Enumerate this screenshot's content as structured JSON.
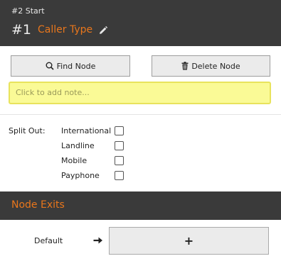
{
  "header": {
    "breadcrumb": "#2 Start",
    "node_number": "#1",
    "node_name": "Caller Type",
    "edit_icon": "pencil-icon"
  },
  "actions": {
    "find_label": "Find Node",
    "find_icon": "search-icon",
    "delete_label": "Delete Node",
    "delete_icon": "trash-icon"
  },
  "note": {
    "placeholder": "Click to add note..."
  },
  "split_out": {
    "label": "Split Out:",
    "options": [
      {
        "label": "International",
        "checked": false
      },
      {
        "label": "Landline",
        "checked": false
      },
      {
        "label": "Mobile",
        "checked": false
      },
      {
        "label": "Payphone",
        "checked": false
      }
    ]
  },
  "exits": {
    "title": "Node Exits",
    "items": [
      {
        "label": "Default",
        "arrow_icon": "arrow-right-icon",
        "add_label": "+"
      }
    ]
  },
  "colors": {
    "header_bg": "#3a3a3a",
    "accent": "#e8761c",
    "note_bg": "#fafa96",
    "button_bg": "#ebebeb"
  }
}
